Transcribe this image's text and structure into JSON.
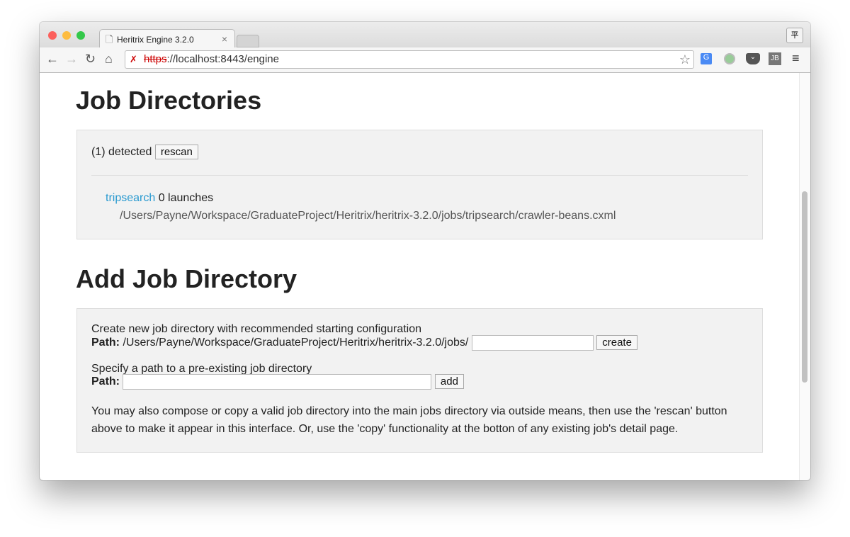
{
  "browser": {
    "tab_title": "Heritrix Engine 3.2.0",
    "url_scheme": "https",
    "url_rest": "://localhost:8443/engine",
    "ext_label": "平",
    "jb_label": "JB"
  },
  "jobdirs": {
    "title": "Job Directories",
    "detected": "(1) detected",
    "rescan": "rescan",
    "job_name": "tripsearch",
    "job_launches": "0 launches",
    "job_path": "/Users/Payne/Workspace/GraduateProject/Heritrix/heritrix-3.2.0/jobs/tripsearch/crawler-beans.cxml"
  },
  "add": {
    "title": "Add Job Directory",
    "create_desc": "Create new job directory with recommended starting configuration",
    "path_label": "Path:",
    "create_prefix": "/Users/Payne/Workspace/GraduateProject/Heritrix/heritrix-3.2.0/jobs/",
    "create_btn": "create",
    "existing_desc": "Specify a path to a pre-existing job directory",
    "add_btn": "add",
    "note": "You may also compose or copy a valid job directory into the main jobs directory via outside means, then use the 'rescan' button above to make it appear in this interface. Or, use the 'copy' functionality at the botton of any existing job's detail page."
  }
}
